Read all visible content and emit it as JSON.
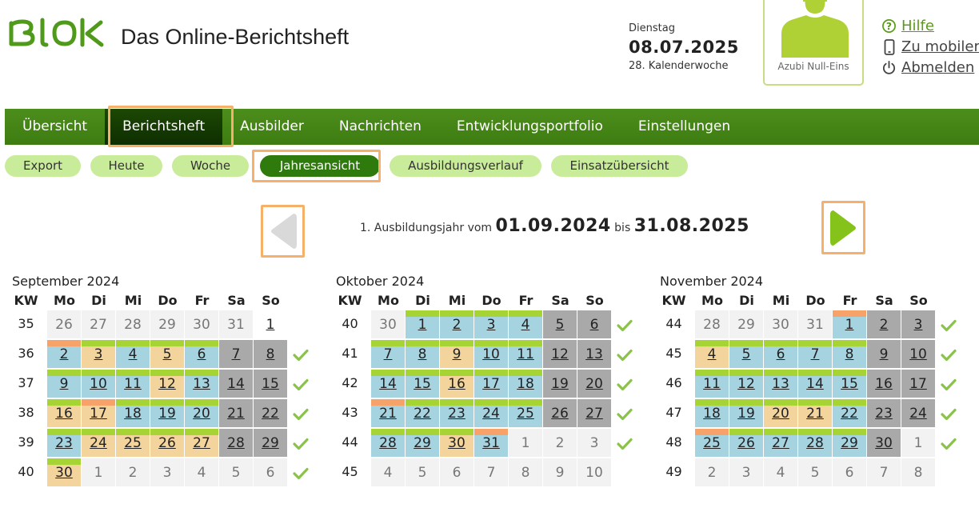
{
  "header": {
    "logo_text": "BLOK",
    "app_title": "Das Online-Berichtsheft",
    "weekday": "Dienstag",
    "date": "08.07.2025",
    "week": "28. Kalenderwoche",
    "user_name": "Azubi Null-Eins",
    "links": {
      "help": "Hilfe",
      "mobile": "Zu mobiler",
      "logout": "Abmelden"
    }
  },
  "nav": {
    "items": [
      "Übersicht",
      "Berichtsheft",
      "Ausbilder",
      "Nachrichten",
      "Entwicklungsportfolio",
      "Einstellungen"
    ],
    "active": 1
  },
  "subnav": {
    "items": [
      "Export",
      "Heute",
      "Woche",
      "Jahresansicht",
      "Ausbildungsverlauf",
      "Einsatzübersicht"
    ],
    "active": 3
  },
  "year": {
    "prefix": "1. Ausbildungsjahr vom",
    "start": "01.09.2024",
    "middle": "bis",
    "end": "31.08.2025"
  },
  "weekday_header": [
    "KW",
    "Mo",
    "Di",
    "Mi",
    "Do",
    "Fr",
    "Sa",
    "So"
  ],
  "colors": {
    "blue": "#a6d3e0",
    "beige": "#f3d49c",
    "gray": "#a9a9a9",
    "green_bar": "#a6d434",
    "orange_bar": "#f7a268",
    "nav_green": "#4c8e1c",
    "check_green": "#8bc34a"
  },
  "months": [
    {
      "title": "September 2024",
      "weeks": [
        {
          "kw": "35",
          "check": false,
          "days": [
            [
              "26",
              "e"
            ],
            [
              "27",
              "e"
            ],
            [
              "28",
              "e"
            ],
            [
              "29",
              "e"
            ],
            [
              "30",
              "e"
            ],
            [
              "31",
              "e"
            ],
            [
              "1",
              "n"
            ]
          ]
        },
        {
          "kw": "36",
          "check": true,
          "days": [
            [
              "2",
              "b",
              "o"
            ],
            [
              "3",
              "y",
              "g"
            ],
            [
              "4",
              "b",
              "g"
            ],
            [
              "5",
              "y",
              "g"
            ],
            [
              "6",
              "b",
              "g"
            ],
            [
              "7",
              "s"
            ],
            [
              "8",
              "s"
            ]
          ]
        },
        {
          "kw": "37",
          "check": true,
          "days": [
            [
              "9",
              "b",
              "g"
            ],
            [
              "10",
              "b",
              "g"
            ],
            [
              "11",
              "b",
              "g"
            ],
            [
              "12",
              "y",
              "g"
            ],
            [
              "13",
              "b",
              "g"
            ],
            [
              "14",
              "s"
            ],
            [
              "15",
              "s"
            ]
          ]
        },
        {
          "kw": "38",
          "check": true,
          "days": [
            [
              "16",
              "y",
              "g"
            ],
            [
              "17",
              "y",
              "o"
            ],
            [
              "18",
              "b",
              "g"
            ],
            [
              "19",
              "b",
              "g"
            ],
            [
              "20",
              "b",
              "g"
            ],
            [
              "21",
              "s"
            ],
            [
              "22",
              "s"
            ]
          ]
        },
        {
          "kw": "39",
          "check": true,
          "days": [
            [
              "23",
              "b",
              "g"
            ],
            [
              "24",
              "y",
              "g"
            ],
            [
              "25",
              "y",
              "g"
            ],
            [
              "26",
              "y",
              "g"
            ],
            [
              "27",
              "y",
              "g"
            ],
            [
              "28",
              "s"
            ],
            [
              "29",
              "s"
            ]
          ]
        },
        {
          "kw": "40",
          "check": true,
          "days": [
            [
              "30",
              "y",
              "g"
            ],
            [
              "1",
              "e"
            ],
            [
              "2",
              "e"
            ],
            [
              "3",
              "e"
            ],
            [
              "4",
              "e"
            ],
            [
              "5",
              "e"
            ],
            [
              "6",
              "e"
            ]
          ]
        }
      ]
    },
    {
      "title": "Oktober 2024",
      "weeks": [
        {
          "kw": "40",
          "check": true,
          "days": [
            [
              "30",
              "e"
            ],
            [
              "1",
              "b",
              "g"
            ],
            [
              "2",
              "b",
              "g"
            ],
            [
              "3",
              "b",
              "g"
            ],
            [
              "4",
              "b",
              "g"
            ],
            [
              "5",
              "s"
            ],
            [
              "6",
              "s"
            ]
          ]
        },
        {
          "kw": "41",
          "check": true,
          "days": [
            [
              "7",
              "b",
              "g"
            ],
            [
              "8",
              "b",
              "g"
            ],
            [
              "9",
              "y",
              "g"
            ],
            [
              "10",
              "b",
              "g"
            ],
            [
              "11",
              "b",
              "g"
            ],
            [
              "12",
              "s"
            ],
            [
              "13",
              "s"
            ]
          ]
        },
        {
          "kw": "42",
          "check": true,
          "days": [
            [
              "14",
              "b",
              "g"
            ],
            [
              "15",
              "b",
              "g"
            ],
            [
              "16",
              "y",
              "g"
            ],
            [
              "17",
              "b",
              "g"
            ],
            [
              "18",
              "b",
              "g"
            ],
            [
              "19",
              "s"
            ],
            [
              "20",
              "s"
            ]
          ]
        },
        {
          "kw": "43",
          "check": true,
          "days": [
            [
              "21",
              "b",
              "o"
            ],
            [
              "22",
              "b",
              "g"
            ],
            [
              "23",
              "b",
              "g"
            ],
            [
              "24",
              "b",
              "g"
            ],
            [
              "25",
              "b",
              "g"
            ],
            [
              "26",
              "s"
            ],
            [
              "27",
              "s"
            ]
          ]
        },
        {
          "kw": "44",
          "check": true,
          "days": [
            [
              "28",
              "b",
              "g"
            ],
            [
              "29",
              "b",
              "g"
            ],
            [
              "30",
              "y",
              "g"
            ],
            [
              "31",
              "b",
              "o"
            ],
            [
              "1",
              "e"
            ],
            [
              "2",
              "e"
            ],
            [
              "3",
              "e"
            ]
          ]
        },
        {
          "kw": "45",
          "check": false,
          "days": [
            [
              "4",
              "e"
            ],
            [
              "5",
              "e"
            ],
            [
              "6",
              "e"
            ],
            [
              "7",
              "e"
            ],
            [
              "8",
              "e"
            ],
            [
              "9",
              "e"
            ],
            [
              "10",
              "e"
            ]
          ]
        }
      ]
    },
    {
      "title": "November 2024",
      "weeks": [
        {
          "kw": "44",
          "check": true,
          "days": [
            [
              "28",
              "e"
            ],
            [
              "29",
              "e"
            ],
            [
              "30",
              "e"
            ],
            [
              "31",
              "e"
            ],
            [
              "1",
              "b",
              "o"
            ],
            [
              "2",
              "s"
            ],
            [
              "3",
              "s"
            ]
          ]
        },
        {
          "kw": "45",
          "check": true,
          "days": [
            [
              "4",
              "y",
              "g"
            ],
            [
              "5",
              "b",
              "g"
            ],
            [
              "6",
              "b",
              "g"
            ],
            [
              "7",
              "b",
              "g"
            ],
            [
              "8",
              "b",
              "g"
            ],
            [
              "9",
              "s"
            ],
            [
              "10",
              "s"
            ]
          ]
        },
        {
          "kw": "46",
          "check": true,
          "days": [
            [
              "11",
              "b",
              "g"
            ],
            [
              "12",
              "b",
              "g"
            ],
            [
              "13",
              "b",
              "g"
            ],
            [
              "14",
              "b",
              "g"
            ],
            [
              "15",
              "b",
              "g"
            ],
            [
              "16",
              "s"
            ],
            [
              "17",
              "s"
            ]
          ]
        },
        {
          "kw": "47",
          "check": true,
          "days": [
            [
              "18",
              "b",
              "g"
            ],
            [
              "19",
              "b",
              "g"
            ],
            [
              "20",
              "y",
              "g"
            ],
            [
              "21",
              "y",
              "g"
            ],
            [
              "22",
              "b",
              "g"
            ],
            [
              "23",
              "s"
            ],
            [
              "24",
              "s"
            ]
          ]
        },
        {
          "kw": "48",
          "check": true,
          "days": [
            [
              "25",
              "b",
              "o"
            ],
            [
              "26",
              "b",
              "g"
            ],
            [
              "27",
              "b",
              "g"
            ],
            [
              "28",
              "b",
              "g"
            ],
            [
              "29",
              "b",
              "g"
            ],
            [
              "30",
              "s"
            ],
            [
              "1",
              "e"
            ]
          ]
        },
        {
          "kw": "49",
          "check": false,
          "days": [
            [
              "2",
              "e"
            ],
            [
              "3",
              "e"
            ],
            [
              "4",
              "e"
            ],
            [
              "5",
              "e"
            ],
            [
              "6",
              "e"
            ],
            [
              "7",
              "e"
            ],
            [
              "8",
              "e"
            ]
          ]
        }
      ]
    }
  ]
}
